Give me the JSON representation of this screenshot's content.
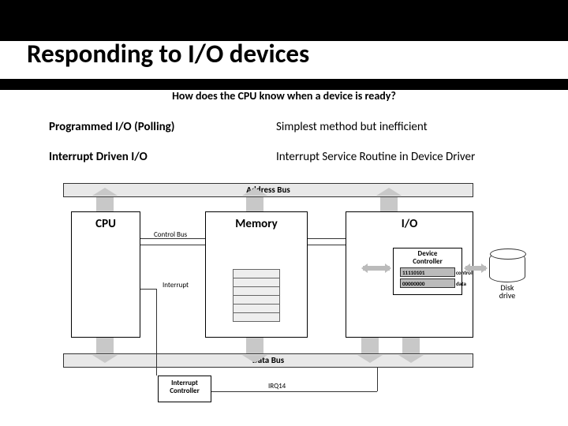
{
  "title": "Responding to I/O devices",
  "question": "How does the CPU know when a device is ready?",
  "table": {
    "row1": {
      "method": "Programmed I/O (Polling)",
      "desc": "Simplest  method but inefficient"
    },
    "row2": {
      "method": "Interrupt Driven I/O",
      "desc": "Interrupt Service Routine in Device Driver"
    }
  },
  "diagram": {
    "address_bus": "Address Bus",
    "data_bus": "Data Bus",
    "cpu": "CPU",
    "memory": "Memory",
    "io": "I/O",
    "control_bus": "Control Bus",
    "interrupt": "Interrupt",
    "interrupt_controller": "Interrupt\nController",
    "irq": "IRQ14",
    "device_controller": "Device\nController",
    "reg1_val": "11110101",
    "reg1_label": "control",
    "reg2_val": "00000000",
    "reg2_label": "data",
    "disk": "Disk\ndrive"
  }
}
